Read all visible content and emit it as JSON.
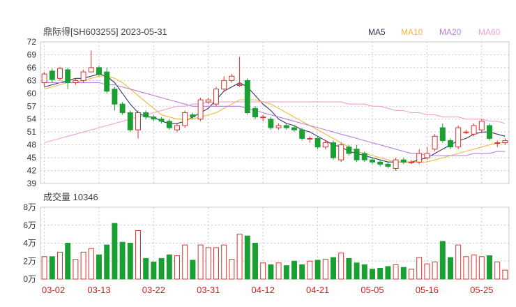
{
  "header": {
    "title": "鼎际得[SH603255] 2023-05-31",
    "ma_legend": [
      {
        "label": "MA5",
        "color": "#333366"
      },
      {
        "label": "MA10",
        "color": "#f5b63d"
      },
      {
        "label": "MA20",
        "color": "#b57ee0"
      },
      {
        "label": "MA60",
        "color": "#f0a0d0"
      }
    ]
  },
  "volume_header": {
    "label": "成交量 10346"
  },
  "colors": {
    "up": "#e0302b",
    "down": "#1aa032",
    "grid": "#c8c8c8",
    "axis_text": "#333333",
    "date_text": "#d2201b"
  },
  "chart_data": [
    {
      "type": "candlestick",
      "title": "鼎际得[SH603255] 2023-05-31",
      "ylim": [
        39,
        72
      ],
      "yticks": [
        72,
        69,
        66,
        63,
        60,
        57,
        54,
        51,
        48,
        45,
        42,
        39
      ],
      "x_labels": [
        "03-02",
        "03-13",
        "03-22",
        "03-31",
        "04-12",
        "04-21",
        "05-05",
        "05-16",
        "05-25"
      ],
      "x_label_index": [
        0,
        7,
        14,
        21,
        28,
        35,
        42,
        49,
        56
      ],
      "candles": [
        [
          62.5,
          64.5,
          65.0,
          61.5
        ],
        [
          65.2,
          63.2,
          65.8,
          62.5
        ],
        [
          63.5,
          65.8,
          66.2,
          63.0
        ],
        [
          65.5,
          62.5,
          66.0,
          61.0
        ],
        [
          62.5,
          63.0,
          63.5,
          62.0
        ],
        [
          63.0,
          65.0,
          65.5,
          62.5
        ],
        [
          65.0,
          66.0,
          70.0,
          65.0
        ],
        [
          66.0,
          64.5,
          66.5,
          64.0
        ],
        [
          65.0,
          60.5,
          66.0,
          60.0
        ],
        [
          61.0,
          57.5,
          61.5,
          56.0
        ],
        [
          57.5,
          55.5,
          58.0,
          55.0
        ],
        [
          55.5,
          51.5,
          56.0,
          51.0
        ],
        [
          51.5,
          55.5,
          56.0,
          49.5
        ],
        [
          55.5,
          54.5,
          56.0,
          54.0
        ],
        [
          54.5,
          54.0,
          55.0,
          53.5
        ],
        [
          54.0,
          53.5,
          54.5,
          53.0
        ],
        [
          53.5,
          52.0,
          54.0,
          51.5
        ],
        [
          51.5,
          52.5,
          53.0,
          51.0
        ],
        [
          52.5,
          55.5,
          56.0,
          52.0
        ],
        [
          55.0,
          54.5,
          55.5,
          54.0
        ],
        [
          54.0,
          58.5,
          59.0,
          53.5
        ],
        [
          58.0,
          58.5,
          59.0,
          57.5
        ],
        [
          57.5,
          61.0,
          61.5,
          57.0
        ],
        [
          61.0,
          63.0,
          64.0,
          60.5
        ],
        [
          63.0,
          64.0,
          64.5,
          62.5
        ],
        [
          62.0,
          62.0,
          68.5,
          61.5
        ],
        [
          63.0,
          55.5,
          63.5,
          55.0
        ],
        [
          56.5,
          54.5,
          57.0,
          54.0
        ],
        [
          54.5,
          54.5,
          55.0,
          53.5
        ],
        [
          54.0,
          52.0,
          54.5,
          51.5
        ],
        [
          52.0,
          52.5,
          53.0,
          51.5
        ],
        [
          52.5,
          52.0,
          53.0,
          51.5
        ],
        [
          52.0,
          51.5,
          52.5,
          51.0
        ],
        [
          51.5,
          49.5,
          52.0,
          49.0
        ],
        [
          49.5,
          49.5,
          50.0,
          48.5
        ],
        [
          49.5,
          47.5,
          50.0,
          47.0
        ],
        [
          47.5,
          48.5,
          49.0,
          47.0
        ],
        [
          48.5,
          45.0,
          49.0,
          44.5
        ],
        [
          44.5,
          48.0,
          48.5,
          44.0
        ],
        [
          47.5,
          46.0,
          48.0,
          45.5
        ],
        [
          47.0,
          44.5,
          48.0,
          44.0
        ],
        [
          46.0,
          44.5,
          46.5,
          44.0
        ],
        [
          44.5,
          44.0,
          45.0,
          43.5
        ],
        [
          44.0,
          43.5,
          44.5,
          43.0
        ],
        [
          43.5,
          43.0,
          44.0,
          42.5
        ],
        [
          42.5,
          44.5,
          45.0,
          42.0
        ],
        [
          44.5,
          44.0,
          45.0,
          43.5
        ],
        [
          44.0,
          44.0,
          44.5,
          43.5
        ],
        [
          44.0,
          46.0,
          47.0,
          43.5
        ],
        [
          45.0,
          46.0,
          47.5,
          44.5
        ],
        [
          47.0,
          50.0,
          50.5,
          46.5
        ],
        [
          52.0,
          49.0,
          53.0,
          48.5
        ],
        [
          49.0,
          47.5,
          49.5,
          47.0
        ],
        [
          47.5,
          52.0,
          52.5,
          47.0
        ],
        [
          51.0,
          51.0,
          51.5,
          50.5
        ],
        [
          50.5,
          52.5,
          53.0,
          50.0
        ],
        [
          51.5,
          53.5,
          54.0,
          51.0
        ],
        [
          52.5,
          49.5,
          53.0,
          49.0
        ],
        [
          48.5,
          48.5,
          49.0,
          47.5
        ],
        [
          48.5,
          49.0,
          49.5,
          48.0
        ]
      ],
      "series": [
        {
          "name": "MA5",
          "values": [
            61.5,
            62.0,
            62.5,
            63.0,
            63.5,
            63.5,
            64.0,
            64.5,
            64.0,
            62.5,
            60.0,
            57.5,
            55.5,
            54.5,
            54.5,
            53.5,
            53.0,
            53.0,
            53.5,
            54.5,
            55.5,
            56.5,
            58.5,
            60.5,
            61.5,
            62.5,
            61.5,
            59.5,
            57.5,
            56.0,
            54.0,
            53.0,
            52.5,
            51.5,
            51.0,
            50.0,
            49.0,
            48.0,
            47.5,
            46.5,
            46.0,
            45.5,
            45.0,
            44.5,
            44.0,
            44.0,
            44.0,
            44.0,
            44.5,
            45.0,
            46.0,
            47.0,
            48.0,
            49.0,
            49.5,
            50.5,
            51.0,
            51.0,
            50.5,
            50.0
          ]
        },
        {
          "name": "MA10",
          "values": [
            61.0,
            61.5,
            62.0,
            62.5,
            62.5,
            63.0,
            63.5,
            64.0,
            64.0,
            63.5,
            62.5,
            61.0,
            59.5,
            58.0,
            56.5,
            55.0,
            54.5,
            54.0,
            54.0,
            54.0,
            54.5,
            55.0,
            55.5,
            56.5,
            57.5,
            58.5,
            58.5,
            58.5,
            58.0,
            57.5,
            56.5,
            55.5,
            54.5,
            53.5,
            52.5,
            51.5,
            50.5,
            49.5,
            48.5,
            47.5,
            46.5,
            46.0,
            45.5,
            45.0,
            44.5,
            44.0,
            44.0,
            44.0,
            44.0,
            44.0,
            44.5,
            45.0,
            45.5,
            46.0,
            46.5,
            47.0,
            47.5,
            48.0,
            48.5,
            48.5
          ]
        },
        {
          "name": "MA20",
          "values": [
            62.5,
            62.5,
            62.5,
            62.5,
            62.5,
            62.5,
            62.5,
            62.5,
            62.0,
            62.0,
            61.5,
            61.0,
            60.5,
            60.0,
            59.5,
            59.0,
            58.5,
            58.0,
            57.5,
            57.0,
            57.0,
            57.0,
            57.0,
            57.0,
            57.0,
            57.0,
            56.5,
            56.0,
            55.5,
            55.0,
            54.5,
            54.0,
            53.5,
            53.0,
            52.5,
            52.0,
            51.5,
            51.0,
            50.5,
            50.0,
            49.5,
            49.0,
            48.5,
            48.0,
            47.5,
            47.0,
            46.5,
            46.0,
            46.0,
            45.5,
            45.5,
            45.5,
            45.5,
            45.5,
            45.5,
            46.0,
            46.0,
            46.0,
            46.5,
            46.5
          ]
        },
        {
          "name": "MA60",
          "values": [
            48.5,
            49.0,
            49.5,
            50.0,
            50.5,
            51.0,
            51.5,
            52.0,
            52.5,
            53.0,
            53.5,
            54.0,
            54.5,
            55.0,
            55.5,
            56.0,
            56.5,
            57.0,
            57.0,
            57.5,
            57.5,
            58.0,
            58.0,
            58.0,
            58.0,
            58.0,
            58.0,
            58.0,
            58.0,
            58.0,
            58.0,
            58.0,
            58.0,
            58.0,
            58.0,
            58.0,
            58.0,
            58.0,
            58.0,
            57.5,
            57.5,
            57.5,
            57.0,
            57.0,
            56.5,
            56.0,
            56.0,
            55.5,
            55.5,
            55.0,
            55.0,
            54.5,
            54.5,
            54.5,
            54.0,
            54.0,
            54.0,
            53.5,
            53.5,
            53.0
          ]
        }
      ]
    },
    {
      "type": "bar",
      "title": "成交量 10346",
      "ylim": [
        0,
        8
      ],
      "yticks": [
        "8万",
        "6万",
        "4万",
        "2万",
        "0万"
      ],
      "values": [
        2.5,
        2.5,
        3.0,
        4.0,
        2.2,
        3.0,
        3.4,
        2.7,
        3.8,
        6.2,
        4.1,
        4.0,
        5.4,
        2.3,
        1.9,
        2.3,
        2.7,
        2.6,
        3.8,
        2.1,
        3.8,
        3.5,
        3.5,
        3.8,
        2.2,
        5.0,
        4.8,
        4.0,
        1.8,
        1.6,
        1.8,
        1.5,
        2.0,
        1.6,
        2.0,
        2.1,
        2.2,
        2.4,
        2.9,
        2.3,
        1.8,
        1.6,
        1.1,
        1.2,
        1.4,
        1.6,
        1.3,
        1.1,
        2.4,
        1.7,
        1.9,
        4.2,
        2.4,
        3.8,
        2.5,
        2.7,
        2.5,
        2.6,
        1.9,
        1.0
      ]
    }
  ]
}
